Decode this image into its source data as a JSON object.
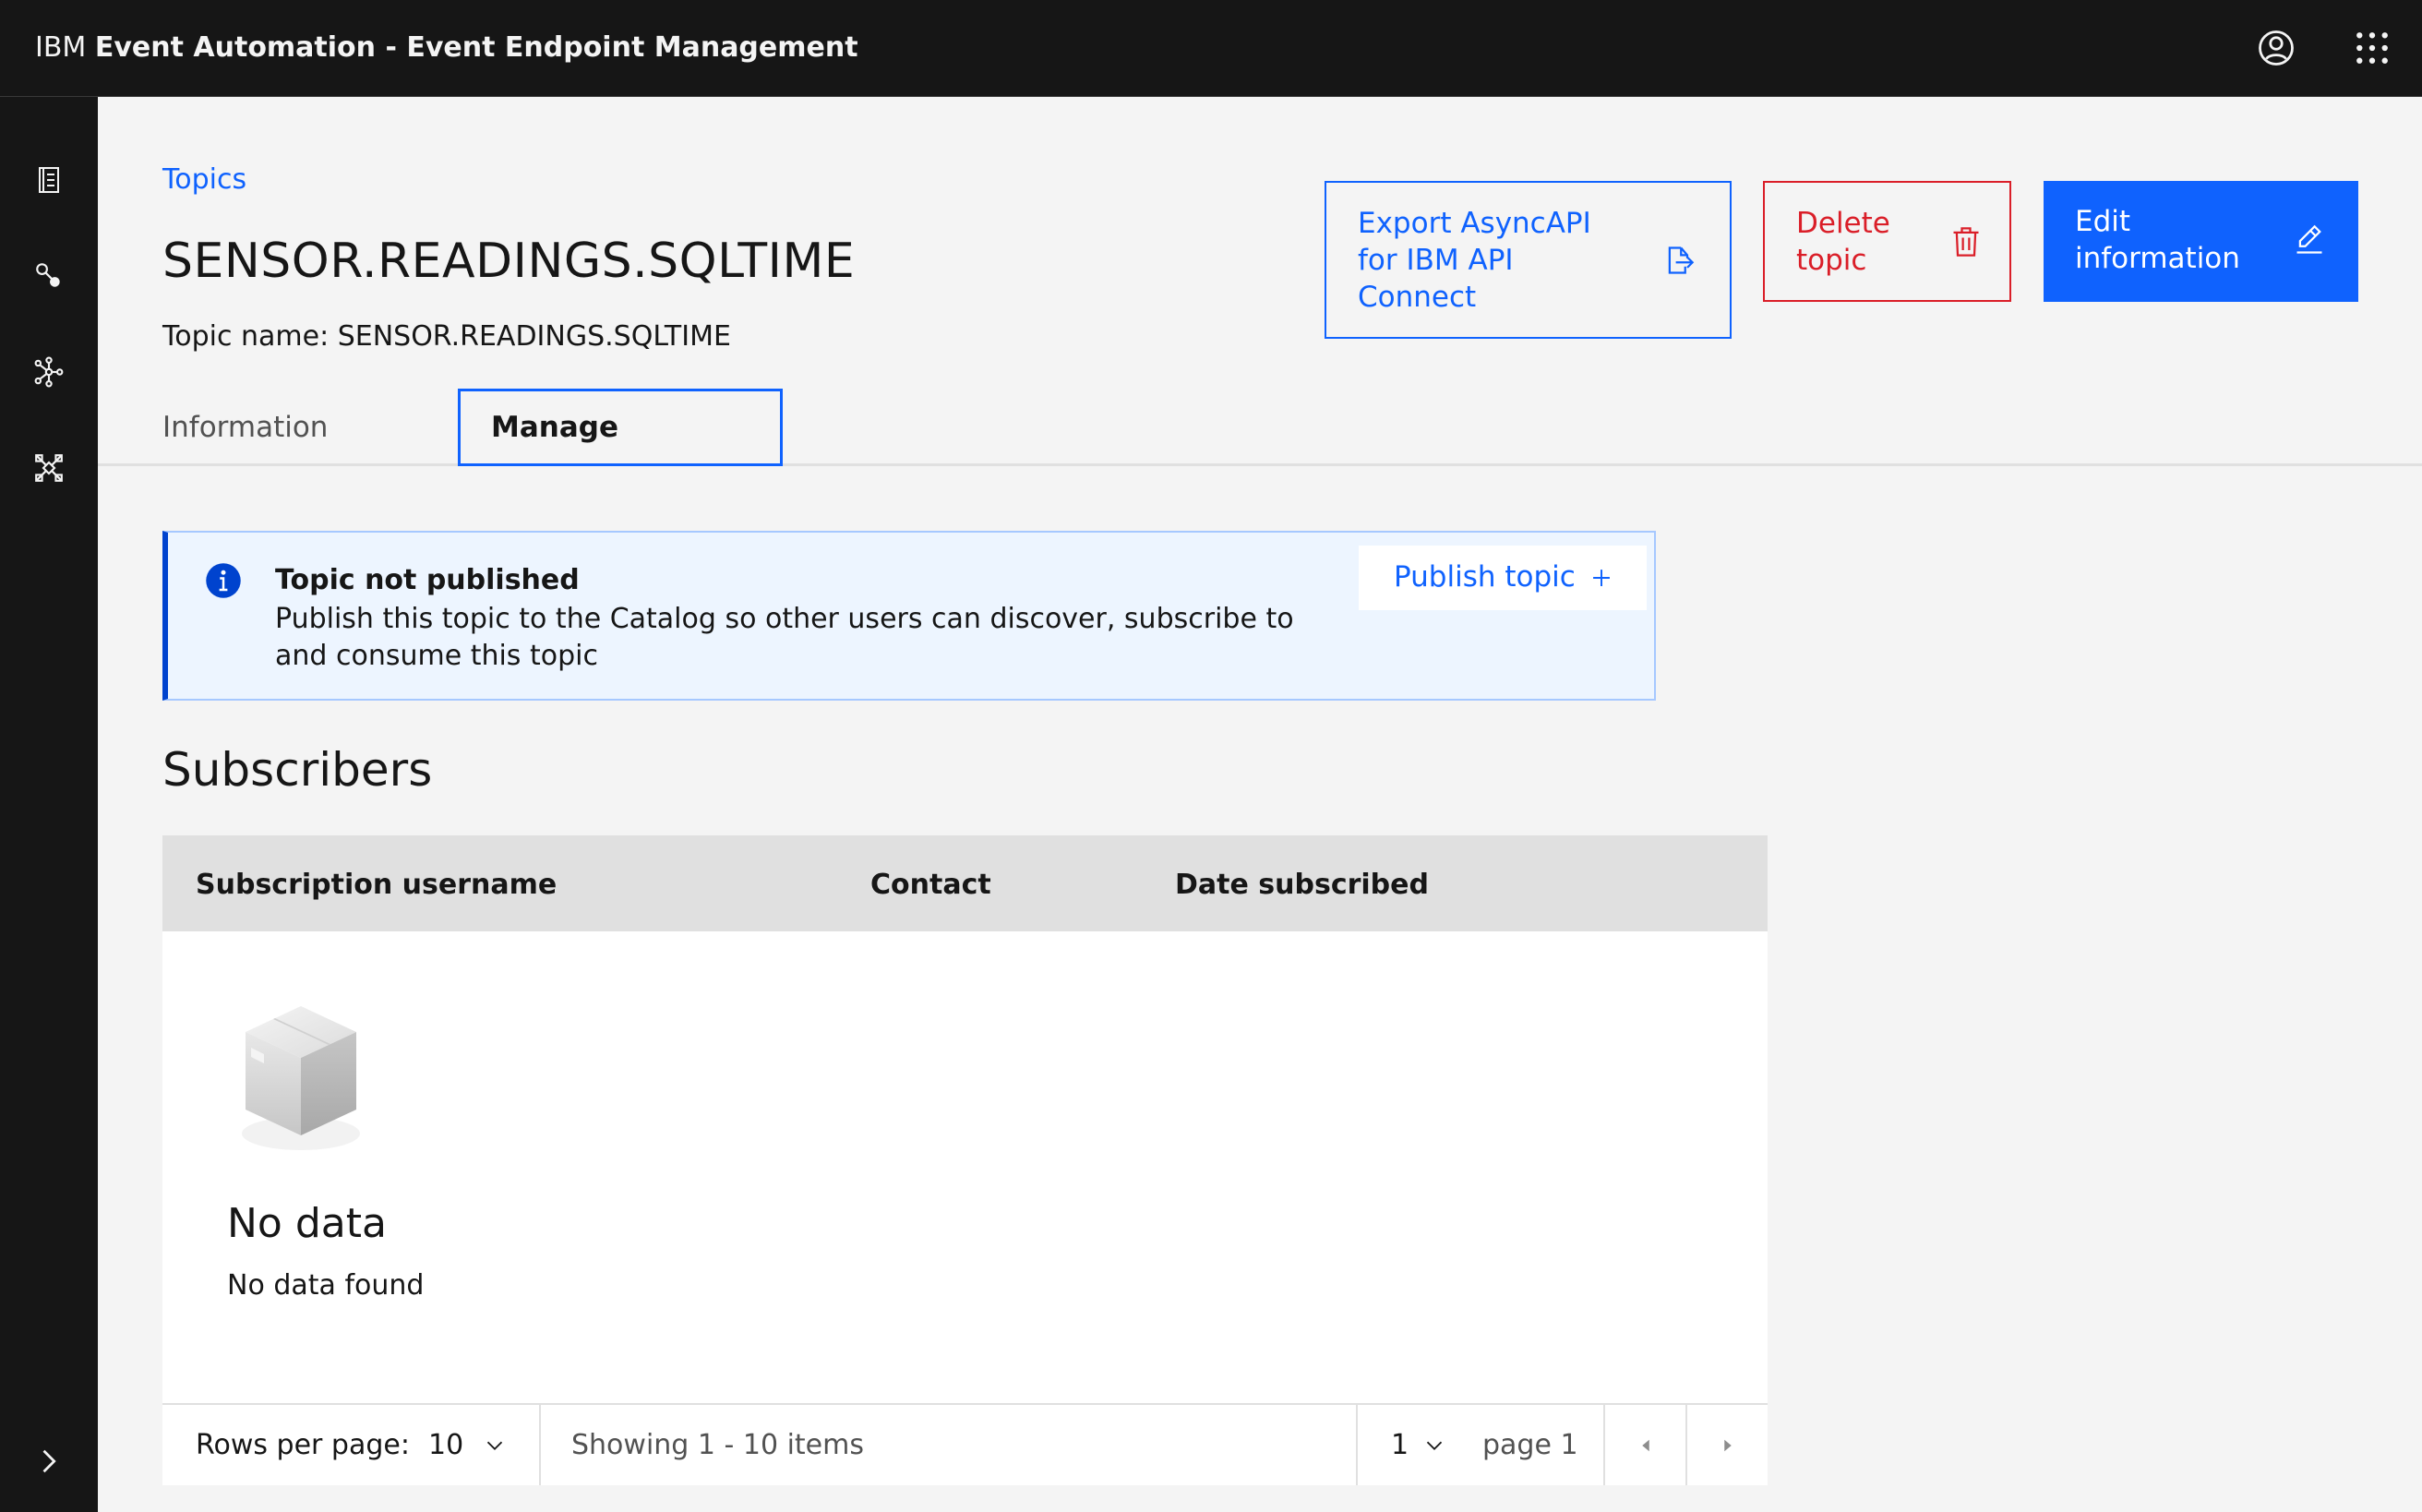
{
  "header": {
    "brand_prefix": "IBM",
    "brand_name": "Event Automation - Event Endpoint Management",
    "user_icon": "user-avatar-icon",
    "switcher_icon": "app-switcher-icon"
  },
  "sidenav": {
    "items": [
      {
        "icon": "catalog-icon"
      },
      {
        "icon": "topics-icon"
      },
      {
        "icon": "gateways-icon"
      },
      {
        "icon": "controls-icon"
      }
    ],
    "collapse_icon": "chevron-right-icon"
  },
  "page": {
    "breadcrumb": "Topics",
    "title": "SENSOR.READINGS.SQLTIME",
    "topic_name_label": "Topic name: SENSOR.READINGS.SQLTIME"
  },
  "actions": {
    "export_label": "Export AsyncAPI for IBM API Connect",
    "delete_label": "Delete topic",
    "edit_label": "Edit information"
  },
  "tabs": [
    {
      "label": "Information",
      "selected": false
    },
    {
      "label": "Manage",
      "selected": true
    }
  ],
  "notification": {
    "title": "Topic not published",
    "body": "Publish this topic to the Catalog so other users can discover, subscribe to and consume this topic",
    "action_label": "Publish topic"
  },
  "subscribers": {
    "title": "Subscribers",
    "columns": [
      "Subscription username",
      "Contact",
      "Date subscribed"
    ],
    "empty_title": "No data",
    "empty_text": "No data found"
  },
  "pagination": {
    "rows_per_page_label": "Rows per page:",
    "rows_per_page_value": "10",
    "showing": "Showing 1 - 10 items",
    "page_value": "1",
    "page_label": "page 1"
  },
  "colors": {
    "primary": "#0f62fe",
    "danger": "#da1e28",
    "header_bg": "#161616",
    "info_bg": "#edf5ff"
  }
}
